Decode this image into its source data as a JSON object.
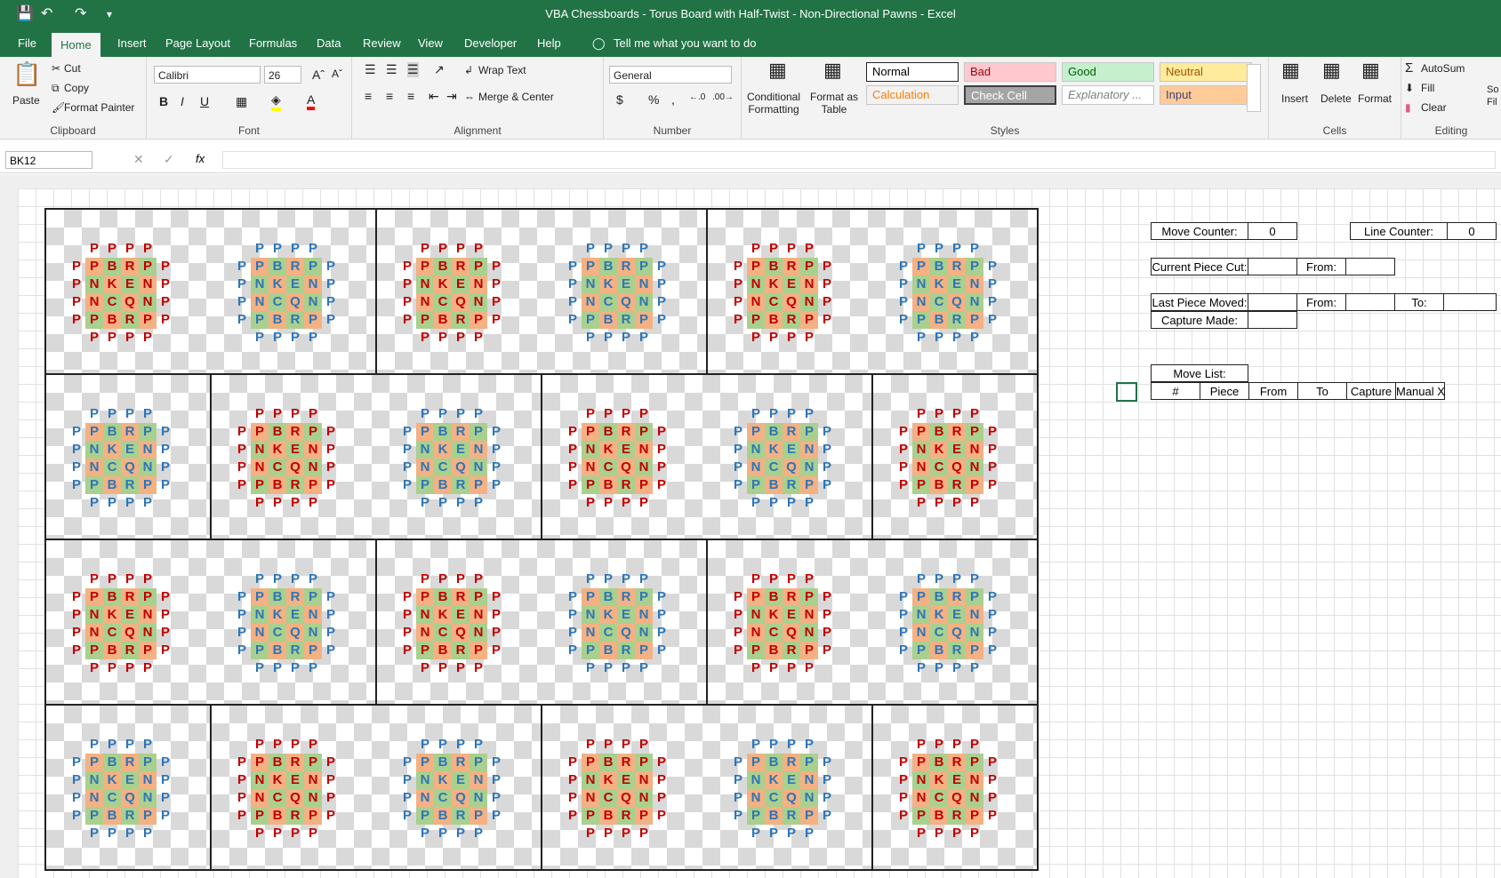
{
  "window": {
    "title": "VBA Chessboards - Torus Board with Half-Twist - Non-Directional Pawns  -  Excel",
    "save_icon": "save-icon",
    "undo_icon": "undo-icon",
    "redo_icon": "redo-icon"
  },
  "menu": {
    "tabs": [
      "File",
      "Home",
      "Insert",
      "Page Layout",
      "Formulas",
      "Data",
      "Review",
      "View",
      "Developer",
      "Help"
    ],
    "active": "Home",
    "tell_me": "Tell me what you want to do"
  },
  "ribbon": {
    "clipboard": {
      "paste": "Paste",
      "cut": "Cut",
      "copy": "Copy",
      "format_painter": "Format Painter",
      "label": "Clipboard"
    },
    "font": {
      "name": "Calibri",
      "size": "26",
      "bold": "B",
      "italic": "I",
      "underline": "U",
      "label": "Font"
    },
    "alignment": {
      "wrap": "Wrap Text",
      "merge": "Merge & Center",
      "label": "Alignment"
    },
    "number": {
      "format": "General",
      "currency": "$",
      "percent": "%",
      "comma": ",",
      "label": "Number"
    },
    "styles": {
      "conditional": "Conditional Formatting",
      "format_table": "Format as Table",
      "label": "Styles",
      "items": [
        {
          "name": "Normal",
          "bg": "#ffffff",
          "fg": "#000000"
        },
        {
          "name": "Bad",
          "bg": "#ffc7ce",
          "fg": "#9c0006"
        },
        {
          "name": "Good",
          "bg": "#c6efce",
          "fg": "#006100"
        },
        {
          "name": "Neutral",
          "bg": "#ffeb9c",
          "fg": "#9c5700"
        },
        {
          "name": "Calculation",
          "bg": "#f2f2f2",
          "fg": "#fa7d00"
        },
        {
          "name": "Check Cell",
          "bg": "#a5a5a5",
          "fg": "#ffffff"
        },
        {
          "name": "Explanatory ...",
          "bg": "#ffffff",
          "fg": "#7f7f7f"
        },
        {
          "name": "Input",
          "bg": "#ffcc99",
          "fg": "#3f3f76"
        }
      ]
    },
    "cells": {
      "insert": "Insert",
      "delete": "Delete",
      "format": "Format",
      "label": "Cells"
    },
    "editing": {
      "autosum": "AutoSum",
      "fill": "Fill",
      "clear": "Clear",
      "sort_partial": "So Fil",
      "label": "Editing"
    }
  },
  "formula_bar": {
    "name_box": "BK12",
    "fx": "fx",
    "value": ""
  },
  "colors": {
    "accent": "#217346",
    "red_piece": "#c00000",
    "blue_piece": "#2e75b6",
    "core_green": "#a9d08e",
    "core_orange": "#f4b183",
    "checker": "#d9d9d9"
  },
  "board": {
    "rows": [
      [
        "P",
        "P",
        "P",
        "P"
      ],
      [
        "P",
        "P",
        "B",
        "R",
        "P",
        "P"
      ],
      [
        "P",
        "N",
        "K",
        "E",
        "N",
        "P"
      ],
      [
        "P",
        "N",
        "C",
        "Q",
        "N",
        "P"
      ],
      [
        "P",
        "P",
        "B",
        "R",
        "P",
        "P"
      ],
      [
        "P",
        "P",
        "P",
        "P"
      ]
    ]
  },
  "side_panel": {
    "move_counter_label": "Move Counter:",
    "move_counter": "0",
    "line_counter_label": "Line Counter:",
    "line_counter": "0",
    "current_piece_label": "Current Piece Cut:",
    "from_label": "From:",
    "last_piece_label": "Last Piece Moved:",
    "from_label2": "From:",
    "to_label": "To:",
    "capture_label": "Capture Made:",
    "move_list_label": "Move List:",
    "columns": [
      "#",
      "Piece",
      "From",
      "To",
      "Capture",
      "Manual X"
    ]
  }
}
